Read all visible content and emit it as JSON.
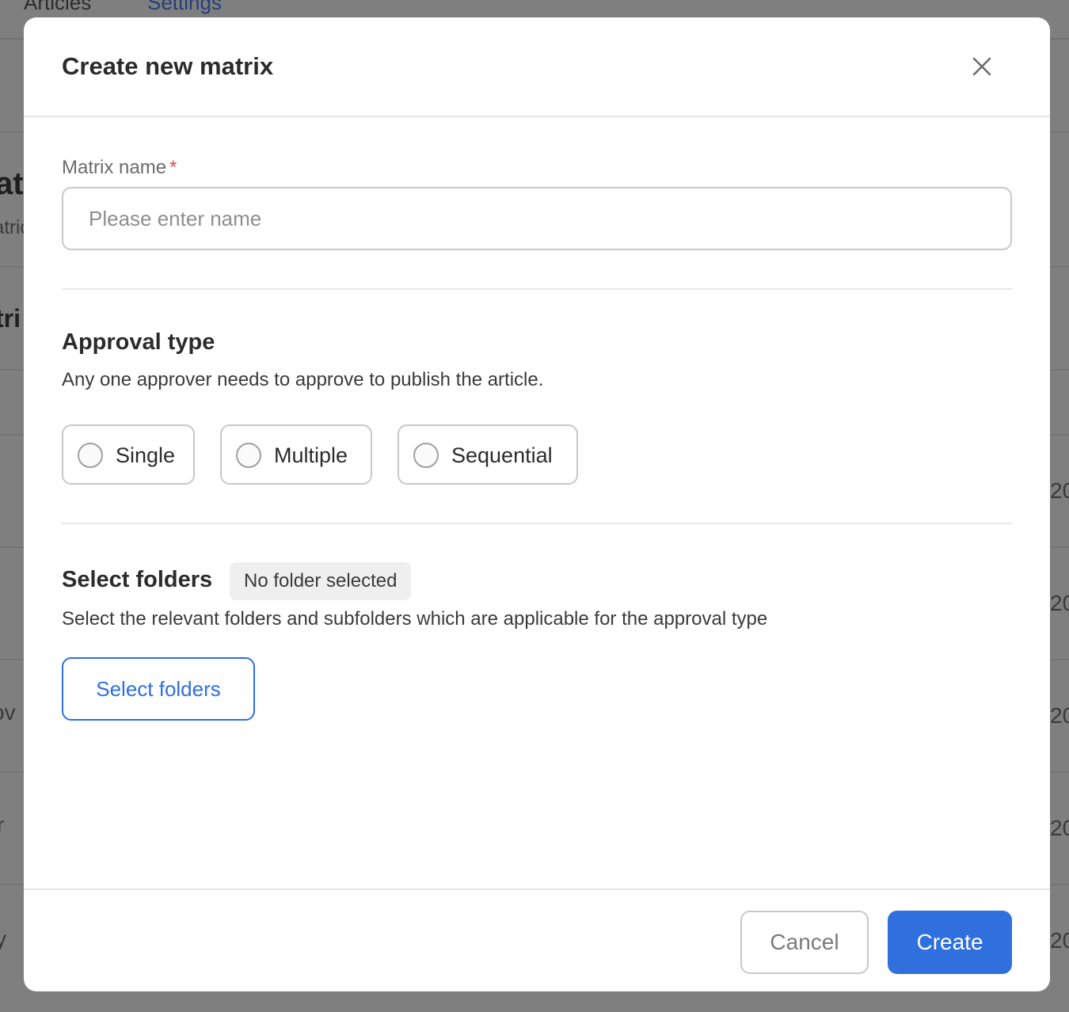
{
  "background": {
    "tabs": [
      "Articles",
      "Settings"
    ],
    "fragments": {
      "title_partial": "at",
      "subtitle_partial": "atric",
      "heading_partial": "tri",
      "row3_left": "ov",
      "row4_left": "r",
      "row5_left": "y",
      "right_col": "20"
    }
  },
  "modal": {
    "title": "Create new matrix",
    "close_icon": "close-icon",
    "matrix_name": {
      "label": "Matrix name",
      "required_marker": "*",
      "placeholder": "Please enter name",
      "value": ""
    },
    "approval": {
      "title": "Approval type",
      "description": "Any one approver needs to approve to publish the article.",
      "options": [
        "Single",
        "Multiple",
        "Sequential"
      ],
      "selected": null
    },
    "folders": {
      "title": "Select folders",
      "badge": "No folder selected",
      "description": "Select the relevant folders and subfolders which are applicable for the approval type",
      "button_label": "Select folders"
    },
    "footer": {
      "cancel_label": "Cancel",
      "create_label": "Create"
    },
    "colors": {
      "accent": "#2f6fde",
      "required": "#e5484d"
    }
  }
}
